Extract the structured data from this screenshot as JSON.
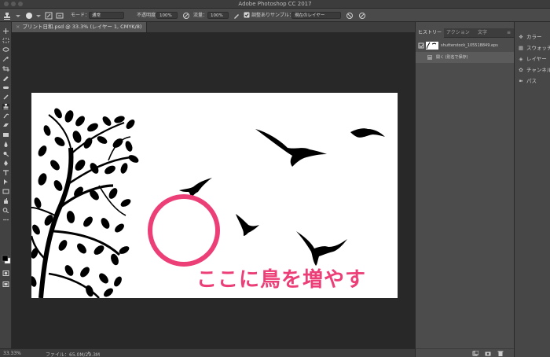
{
  "app": {
    "title": "Adobe Photoshop CC 2017"
  },
  "options": {
    "mode_label": "モード：",
    "mode_value": "通常",
    "opacity_label": "不透明度：",
    "opacity_value": "100%",
    "flow_label": "流量：",
    "flow_value": "100%",
    "align_label": "調整あり",
    "sample_label": "サンプル：",
    "sample_value": "現在のレイヤー"
  },
  "document": {
    "tab_title": "プリント日和.psd @ 33.3% (レイヤー 1, CMYK/8)",
    "close_glyph": "×"
  },
  "canvas": {
    "caption": "ここに鳥を増やす",
    "accent_color": "#ec3f78"
  },
  "status": {
    "zoom": "33.33%",
    "file_info": "ファイル：65.0M/29.3M"
  },
  "history_panel": {
    "tabs": [
      "ヒストリー",
      "アクション",
      "文字"
    ],
    "items": [
      "shutterstock_105518849.eps",
      "開く (別名で保存)"
    ]
  },
  "side_panel": {
    "items": [
      {
        "label": "カラー",
        "icon": "color-wheel-icon"
      },
      {
        "label": "スウォッチ",
        "icon": "swatches-icon"
      },
      {
        "label": "レイヤー",
        "icon": "layers-icon"
      },
      {
        "label": "チャンネル",
        "icon": "channels-icon"
      },
      {
        "label": "パス",
        "icon": "paths-icon"
      }
    ]
  }
}
